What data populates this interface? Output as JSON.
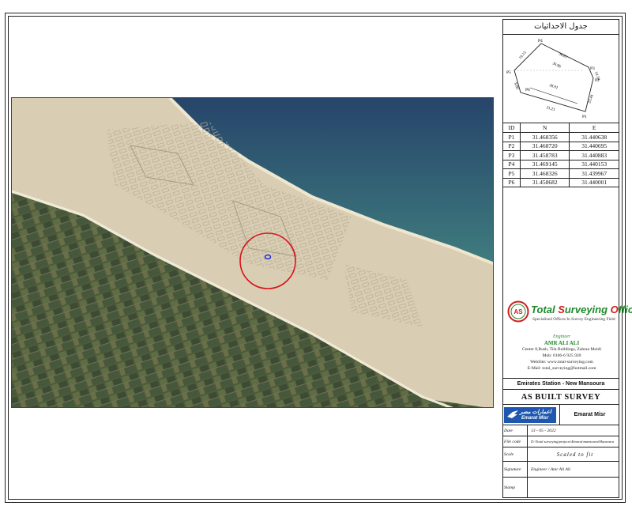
{
  "coordinates_table": {
    "title": "جدول الاحداثيات",
    "headers": [
      "ID",
      "N",
      "E"
    ],
    "rows": [
      {
        "id": "P1",
        "n": "31.468356",
        "e": "31.440638"
      },
      {
        "id": "P2",
        "n": "31.468720",
        "e": "31.440695"
      },
      {
        "id": "P3",
        "n": "31.458783",
        "e": "31.440883"
      },
      {
        "id": "P4",
        "n": "31.469145",
        "e": "31.440153"
      },
      {
        "id": "P5",
        "n": "31.468326",
        "e": "31.439967"
      },
      {
        "id": "P6",
        "n": "31.458682",
        "e": "31.440001"
      }
    ]
  },
  "sketch": {
    "points": [
      "P1",
      "P2",
      "P3",
      "P4",
      "P5",
      "P6"
    ],
    "dims": [
      "36.61",
      "36.96",
      "38.91",
      "33.23",
      "19.15",
      "14.34",
      "23.44",
      "8.80"
    ]
  },
  "office": {
    "name_part1": "Total ",
    "name_s": "S",
    "name_part2": "urveying ",
    "name_o": "O",
    "name_part3": "ffice",
    "tagline": "Specialized Offices In Survey Engineering Field",
    "by_label": "Engineer",
    "engineer": "AMR ALI ALI",
    "address": "Center 8,Rush, Tila Buildings, Zahraa Moidi",
    "mob": "Mob: 0106-6 925 920",
    "website": "WebSite: www.total-surveying.com",
    "email": "E-Mail: total_surveying@hotmail.com"
  },
  "title_block": {
    "project": "Emirates Station - New Mansoura",
    "title": "AS BUILT SURVEY",
    "client_ar": "اعمارات مصر",
    "client_en": "Emarat Misr",
    "client_name": "Emarat Misr",
    "date_label": "Date",
    "date": "13 - 05 - 2022",
    "file_label": "File code",
    "file_code": "D:\\Total surveying\\projects\\Emarat\\mansoura\\Mansoura",
    "scale_label": "Scale",
    "scale": "Scaled to fit",
    "signature_label": "Signature",
    "signature": "Engineer / Amr Ali Ali",
    "stamp_label": "Stamp"
  },
  "colors": {
    "office_green": "#1f8a2a",
    "office_red": "#d21d1d",
    "client_blue": "#1d57b0",
    "marker_red": "#d8141b",
    "marker_blue": "#1c2fd8"
  }
}
